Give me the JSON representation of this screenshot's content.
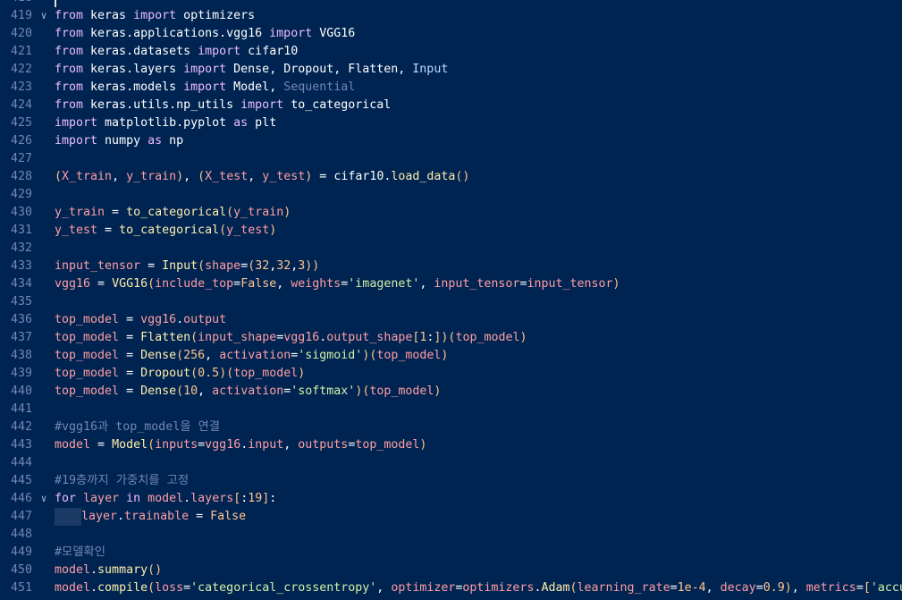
{
  "editor": {
    "colors": {
      "background": "#002451",
      "line_number": "#7285b7",
      "keyword": "#ebbbff",
      "function": "#ffeead",
      "string": "#d1f1a9",
      "number": "#ffc58f",
      "comment": "#7285b7",
      "variable": "#ff9da4"
    },
    "icons": {
      "fold": "chevron-down-icon"
    },
    "lines": [
      {
        "n": "418",
        "fold": false,
        "indent": false,
        "tokens": []
      },
      {
        "n": "419",
        "fold": true,
        "indent": false,
        "tokens": [
          [
            "kw",
            "from"
          ],
          [
            "p",
            " keras "
          ],
          [
            "kw",
            "import"
          ],
          [
            "p",
            " optimizers"
          ]
        ]
      },
      {
        "n": "420",
        "fold": false,
        "indent": false,
        "tokens": [
          [
            "kw",
            "from"
          ],
          [
            "p",
            " keras.applications.vgg16 "
          ],
          [
            "kw",
            "import"
          ],
          [
            "p",
            " VGG16"
          ]
        ]
      },
      {
        "n": "421",
        "fold": false,
        "indent": false,
        "tokens": [
          [
            "kw",
            "from"
          ],
          [
            "p",
            " keras.datasets "
          ],
          [
            "kw",
            "import"
          ],
          [
            "p",
            " cifar10"
          ]
        ]
      },
      {
        "n": "422",
        "fold": false,
        "indent": false,
        "tokens": [
          [
            "kw",
            "from"
          ],
          [
            "p",
            " keras.layers "
          ],
          [
            "kw",
            "import"
          ],
          [
            "p",
            " Dense, Dropout, Flatten, "
          ],
          [
            "prm",
            "Input"
          ]
        ]
      },
      {
        "n": "423",
        "fold": false,
        "indent": false,
        "tokens": [
          [
            "kw",
            "from"
          ],
          [
            "p",
            " keras.models "
          ],
          [
            "kw",
            "import"
          ],
          [
            "p",
            " Model, "
          ],
          [
            "cm",
            "Sequential"
          ]
        ]
      },
      {
        "n": "424",
        "fold": false,
        "indent": false,
        "tokens": [
          [
            "kw",
            "from"
          ],
          [
            "p",
            " keras.utils.np_utils "
          ],
          [
            "kw",
            "import"
          ],
          [
            "p",
            " to_categorical"
          ]
        ]
      },
      {
        "n": "425",
        "fold": false,
        "indent": false,
        "tokens": [
          [
            "kw",
            "import"
          ],
          [
            "p",
            " matplotlib.pyplot "
          ],
          [
            "kw",
            "as"
          ],
          [
            "p",
            " plt"
          ]
        ]
      },
      {
        "n": "426",
        "fold": false,
        "indent": false,
        "tokens": [
          [
            "kw",
            "import"
          ],
          [
            "p",
            " numpy "
          ],
          [
            "kw",
            "as"
          ],
          [
            "p",
            " np"
          ]
        ]
      },
      {
        "n": "427",
        "fold": false,
        "indent": false,
        "tokens": []
      },
      {
        "n": "428",
        "fold": false,
        "indent": false,
        "tokens": [
          [
            "pb",
            "("
          ],
          [
            "var",
            "X_train"
          ],
          [
            "p",
            ", "
          ],
          [
            "var",
            "y_train"
          ],
          [
            "pb",
            ")"
          ],
          [
            "p",
            ", "
          ],
          [
            "pb",
            "("
          ],
          [
            "var",
            "X_test"
          ],
          [
            "p",
            ", "
          ],
          [
            "var",
            "y_test"
          ],
          [
            "pb",
            ")"
          ],
          [
            "p",
            " = cifar10."
          ],
          [
            "fn",
            "load_data"
          ],
          [
            "pb",
            "()"
          ]
        ]
      },
      {
        "n": "429",
        "fold": false,
        "indent": false,
        "tokens": []
      },
      {
        "n": "430",
        "fold": false,
        "indent": false,
        "tokens": [
          [
            "var",
            "y_train"
          ],
          [
            "p",
            " = "
          ],
          [
            "fn",
            "to_categorical"
          ],
          [
            "pb",
            "("
          ],
          [
            "var",
            "y_train"
          ],
          [
            "pb",
            ")"
          ]
        ]
      },
      {
        "n": "431",
        "fold": false,
        "indent": false,
        "tokens": [
          [
            "var",
            "y_test"
          ],
          [
            "p",
            " = "
          ],
          [
            "fn",
            "to_categorical"
          ],
          [
            "pb",
            "("
          ],
          [
            "var",
            "y_test"
          ],
          [
            "pb",
            ")"
          ]
        ]
      },
      {
        "n": "432",
        "fold": false,
        "indent": false,
        "tokens": []
      },
      {
        "n": "433",
        "fold": false,
        "indent": false,
        "tokens": [
          [
            "var",
            "input_tensor"
          ],
          [
            "p",
            " = "
          ],
          [
            "fn",
            "Input"
          ],
          [
            "pb",
            "("
          ],
          [
            "var",
            "shape"
          ],
          [
            "p",
            "="
          ],
          [
            "pb",
            "("
          ],
          [
            "num",
            "32"
          ],
          [
            "p",
            ","
          ],
          [
            "num",
            "32"
          ],
          [
            "p",
            ","
          ],
          [
            "num",
            "3"
          ],
          [
            "pb",
            "))"
          ]
        ]
      },
      {
        "n": "434",
        "fold": false,
        "indent": false,
        "tokens": [
          [
            "var",
            "vgg16"
          ],
          [
            "p",
            " = "
          ],
          [
            "fn",
            "VGG16"
          ],
          [
            "pb",
            "("
          ],
          [
            "var",
            "include_top"
          ],
          [
            "p",
            "="
          ],
          [
            "num",
            "False"
          ],
          [
            "p",
            ", "
          ],
          [
            "var",
            "weights"
          ],
          [
            "p",
            "="
          ],
          [
            "str",
            "'imagenet'"
          ],
          [
            "p",
            ", "
          ],
          [
            "var",
            "input_tensor"
          ],
          [
            "p",
            "="
          ],
          [
            "var",
            "input_tensor"
          ],
          [
            "pb",
            ")"
          ]
        ]
      },
      {
        "n": "435",
        "fold": false,
        "indent": false,
        "tokens": []
      },
      {
        "n": "436",
        "fold": false,
        "indent": false,
        "tokens": [
          [
            "var",
            "top_model"
          ],
          [
            "p",
            " = "
          ],
          [
            "var",
            "vgg16"
          ],
          [
            "p",
            "."
          ],
          [
            "var",
            "output"
          ]
        ]
      },
      {
        "n": "437",
        "fold": false,
        "indent": false,
        "tokens": [
          [
            "var",
            "top_model"
          ],
          [
            "p",
            " = "
          ],
          [
            "fn",
            "Flatten"
          ],
          [
            "pb",
            "("
          ],
          [
            "var",
            "input_shape"
          ],
          [
            "p",
            "="
          ],
          [
            "var",
            "vgg16"
          ],
          [
            "p",
            "."
          ],
          [
            "var",
            "output_shape"
          ],
          [
            "pb",
            "["
          ],
          [
            "num",
            "1"
          ],
          [
            "p",
            ":"
          ],
          [
            "pb",
            "])("
          ],
          [
            "var",
            "top_model"
          ],
          [
            "pb",
            ")"
          ]
        ]
      },
      {
        "n": "438",
        "fold": false,
        "indent": false,
        "tokens": [
          [
            "var",
            "top_model"
          ],
          [
            "p",
            " = "
          ],
          [
            "fn",
            "Dense"
          ],
          [
            "pb",
            "("
          ],
          [
            "num",
            "256"
          ],
          [
            "p",
            ", "
          ],
          [
            "var",
            "activation"
          ],
          [
            "p",
            "="
          ],
          [
            "str",
            "'sigmoid'"
          ],
          [
            "pb",
            ")("
          ],
          [
            "var",
            "top_model"
          ],
          [
            "pb",
            ")"
          ]
        ]
      },
      {
        "n": "439",
        "fold": false,
        "indent": false,
        "tokens": [
          [
            "var",
            "top_model"
          ],
          [
            "p",
            " = "
          ],
          [
            "fn",
            "Dropout"
          ],
          [
            "pb",
            "("
          ],
          [
            "num",
            "0.5"
          ],
          [
            "pb",
            ")("
          ],
          [
            "var",
            "top_model"
          ],
          [
            "pb",
            ")"
          ]
        ]
      },
      {
        "n": "440",
        "fold": false,
        "indent": false,
        "tokens": [
          [
            "var",
            "top_model"
          ],
          [
            "p",
            " = "
          ],
          [
            "fn",
            "Dense"
          ],
          [
            "pb",
            "("
          ],
          [
            "num",
            "10"
          ],
          [
            "p",
            ", "
          ],
          [
            "var",
            "activation"
          ],
          [
            "p",
            "="
          ],
          [
            "str",
            "'softmax'"
          ],
          [
            "pb",
            ")("
          ],
          [
            "var",
            "top_model"
          ],
          [
            "pb",
            ")"
          ]
        ]
      },
      {
        "n": "441",
        "fold": false,
        "indent": false,
        "tokens": []
      },
      {
        "n": "442",
        "fold": false,
        "indent": false,
        "tokens": [
          [
            "cm",
            "#vgg16과 top_model을 연결"
          ]
        ]
      },
      {
        "n": "443",
        "fold": false,
        "indent": false,
        "tokens": [
          [
            "var",
            "model"
          ],
          [
            "p",
            " = "
          ],
          [
            "fn",
            "Model"
          ],
          [
            "pb",
            "("
          ],
          [
            "var",
            "inputs"
          ],
          [
            "p",
            "="
          ],
          [
            "var",
            "vgg16"
          ],
          [
            "p",
            "."
          ],
          [
            "var",
            "input"
          ],
          [
            "p",
            ", "
          ],
          [
            "var",
            "outputs"
          ],
          [
            "p",
            "="
          ],
          [
            "var",
            "top_model"
          ],
          [
            "pb",
            ")"
          ]
        ]
      },
      {
        "n": "444",
        "fold": false,
        "indent": false,
        "tokens": []
      },
      {
        "n": "445",
        "fold": false,
        "indent": false,
        "tokens": [
          [
            "cm",
            "#19층까지 가중치를 고정"
          ]
        ]
      },
      {
        "n": "446",
        "fold": true,
        "indent": false,
        "tokens": [
          [
            "kw",
            "for"
          ],
          [
            "p",
            " "
          ],
          [
            "var",
            "layer"
          ],
          [
            "p",
            " "
          ],
          [
            "kw",
            "in"
          ],
          [
            "p",
            " "
          ],
          [
            "var",
            "model"
          ],
          [
            "p",
            "."
          ],
          [
            "var",
            "layers"
          ],
          [
            "pb",
            "["
          ],
          [
            "p",
            ":"
          ],
          [
            "num",
            "19"
          ],
          [
            "pb",
            "]"
          ],
          [
            "p",
            ":"
          ]
        ]
      },
      {
        "n": "447",
        "fold": false,
        "indent": true,
        "tokens": [
          [
            "var",
            "layer"
          ],
          [
            "p",
            "."
          ],
          [
            "var",
            "trainable"
          ],
          [
            "p",
            " = "
          ],
          [
            "num",
            "False"
          ]
        ]
      },
      {
        "n": "448",
        "fold": false,
        "indent": false,
        "tokens": []
      },
      {
        "n": "449",
        "fold": false,
        "indent": false,
        "tokens": [
          [
            "cm",
            "#모델확인"
          ]
        ]
      },
      {
        "n": "450",
        "fold": false,
        "indent": false,
        "tokens": [
          [
            "var",
            "model"
          ],
          [
            "p",
            "."
          ],
          [
            "fn",
            "summary"
          ],
          [
            "pb",
            "()"
          ]
        ]
      },
      {
        "n": "451",
        "fold": false,
        "indent": false,
        "tokens": [
          [
            "var",
            "model"
          ],
          [
            "p",
            "."
          ],
          [
            "fn",
            "compile"
          ],
          [
            "pb",
            "("
          ],
          [
            "var",
            "loss"
          ],
          [
            "p",
            "="
          ],
          [
            "str",
            "'categorical_crossentropy'"
          ],
          [
            "p",
            ", "
          ],
          [
            "var",
            "optimizer"
          ],
          [
            "p",
            "="
          ],
          [
            "var",
            "optimizers"
          ],
          [
            "p",
            "."
          ],
          [
            "fn",
            "Adam"
          ],
          [
            "pb",
            "("
          ],
          [
            "var",
            "learning_rate"
          ],
          [
            "p",
            "="
          ],
          [
            "num",
            "1e-4"
          ],
          [
            "p",
            ", "
          ],
          [
            "var",
            "decay"
          ],
          [
            "p",
            "="
          ],
          [
            "num",
            "0.9"
          ],
          [
            "pb",
            ")"
          ],
          [
            "p",
            ", "
          ],
          [
            "var",
            "metrics"
          ],
          [
            "p",
            "="
          ],
          [
            "pb",
            "["
          ],
          [
            "str",
            "'accuracy'"
          ],
          [
            "pb",
            "])"
          ]
        ]
      }
    ]
  }
}
